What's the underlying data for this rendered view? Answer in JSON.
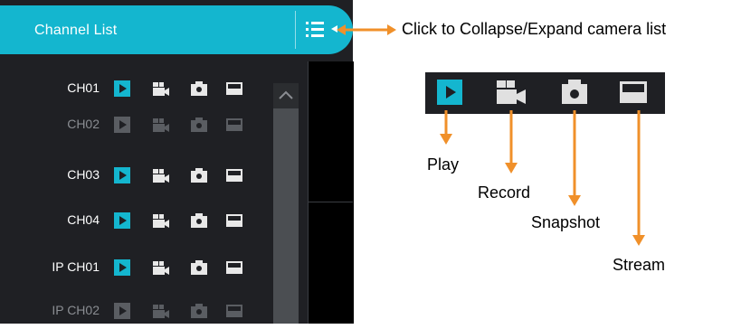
{
  "panel": {
    "title": "Channel List",
    "collapse_icon": "list-icon",
    "accent_color": "#14b6cf"
  },
  "channels": [
    {
      "label": "CH01",
      "enabled": true
    },
    {
      "label": "CH02",
      "enabled": false
    },
    {
      "label": "CH03",
      "enabled": true
    },
    {
      "label": "CH04",
      "enabled": true
    },
    {
      "label": "IP CH01",
      "enabled": true
    },
    {
      "label": "IP CH02",
      "enabled": false
    }
  ],
  "channel_icons": [
    "play-icon",
    "record-icon",
    "snapshot-icon",
    "stream-icon"
  ],
  "annotations": {
    "collapse_hint": "Click to Collapse/Expand camera list",
    "play": "Play",
    "record": "Record",
    "snapshot": "Snapshot",
    "stream": "Stream",
    "arrow_color": "#f0902a"
  }
}
